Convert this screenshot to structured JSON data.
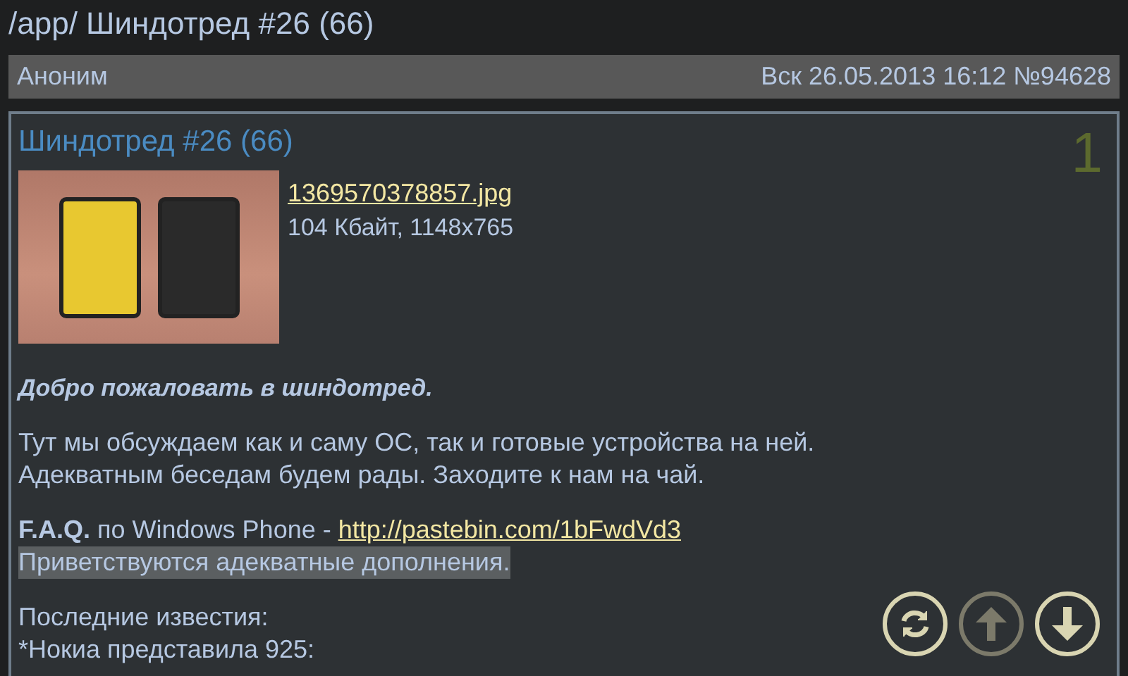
{
  "page_title": "/app/ Шиндотред #26 (66)",
  "post_header": {
    "author": "Аноним",
    "date": "Вск 26.05.2013 16:12 №94628"
  },
  "post": {
    "title": "Шиндотред #26 (66)",
    "number": "1",
    "attachment": {
      "filename": "1369570378857.jpg",
      "info": "104 Кбайт, 1148x765"
    },
    "paragraphs": [
      {
        "kind": "heading",
        "lines": [
          {
            "text": "Добро пожаловать в шиндотред.",
            "highlighted": false
          }
        ]
      },
      {
        "kind": "text",
        "lines": [
          {
            "text": "Тут мы обсуждаем как и саму ОС, так и готовые устройства на ней.",
            "highlighted": false
          },
          {
            "text": "Адекватным беседам будем рады. Заходите к нам на чай.",
            "highlighted": false
          }
        ]
      },
      {
        "kind": "text",
        "lines": [
          {
            "text": "**F.A.Q.** по Windows Phone - ",
            "link": "http://pastebin.com/1bFwdVd3",
            "highlighted": false
          },
          {
            "text": "Приветствуются адекватные дополнения.",
            "highlighted": true
          }
        ]
      },
      {
        "kind": "text",
        "lines": [
          {
            "text": "Последние известия:",
            "highlighted": false
          },
          {
            "text": "*Нокиа представила 925:",
            "highlighted": false
          }
        ]
      }
    ]
  },
  "buttons": [
    {
      "kind": "refresh",
      "disabled": false
    },
    {
      "kind": "up",
      "disabled": true
    },
    {
      "kind": "down",
      "disabled": false
    }
  ]
}
